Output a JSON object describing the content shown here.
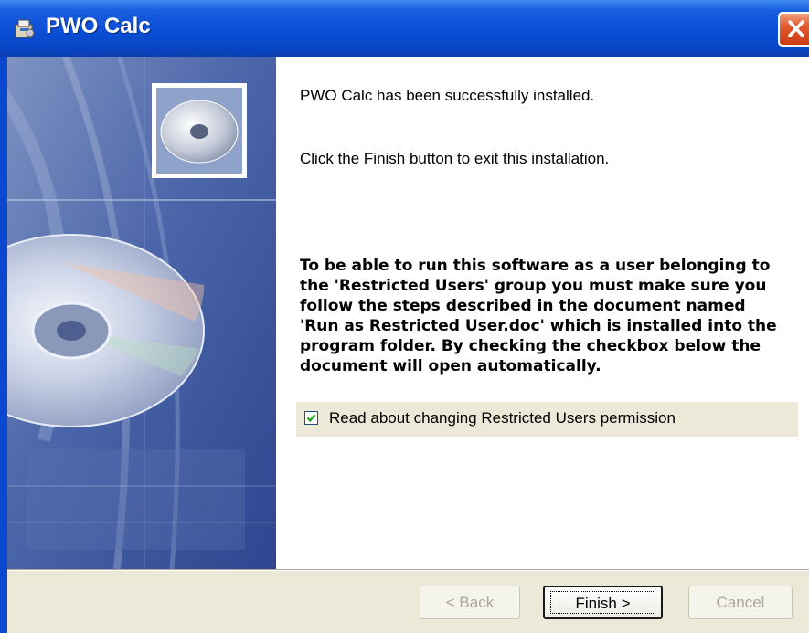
{
  "window": {
    "title": "PWO Calc",
    "icon": "installer-icon",
    "close_icon": "close-icon"
  },
  "content": {
    "message1": "PWO Calc has been successfully installed.",
    "message2": "Click the Finish button to exit this installation.",
    "restricted_info_lines": [
      "To be able to run this software as a user belonging to",
      "the 'Restricted Users' group you must make sure you",
      "follow the steps described in the document named",
      "'Run as Restricted User.doc' which is installed into the",
      "program folder. By checking the checkbox below the",
      "document will open automatically."
    ],
    "checkbox": {
      "label": "Read about changing Restricted Users permission",
      "checked": true
    }
  },
  "buttons": {
    "back_label": "< Back",
    "finish_label": "Finish >",
    "cancel_label": "Cancel"
  },
  "colors": {
    "titlebar": "#0a4fd6",
    "dialog_face": "#ece9d8",
    "close_button": "#e2592f",
    "banner_blue": "#3f5fa8"
  }
}
